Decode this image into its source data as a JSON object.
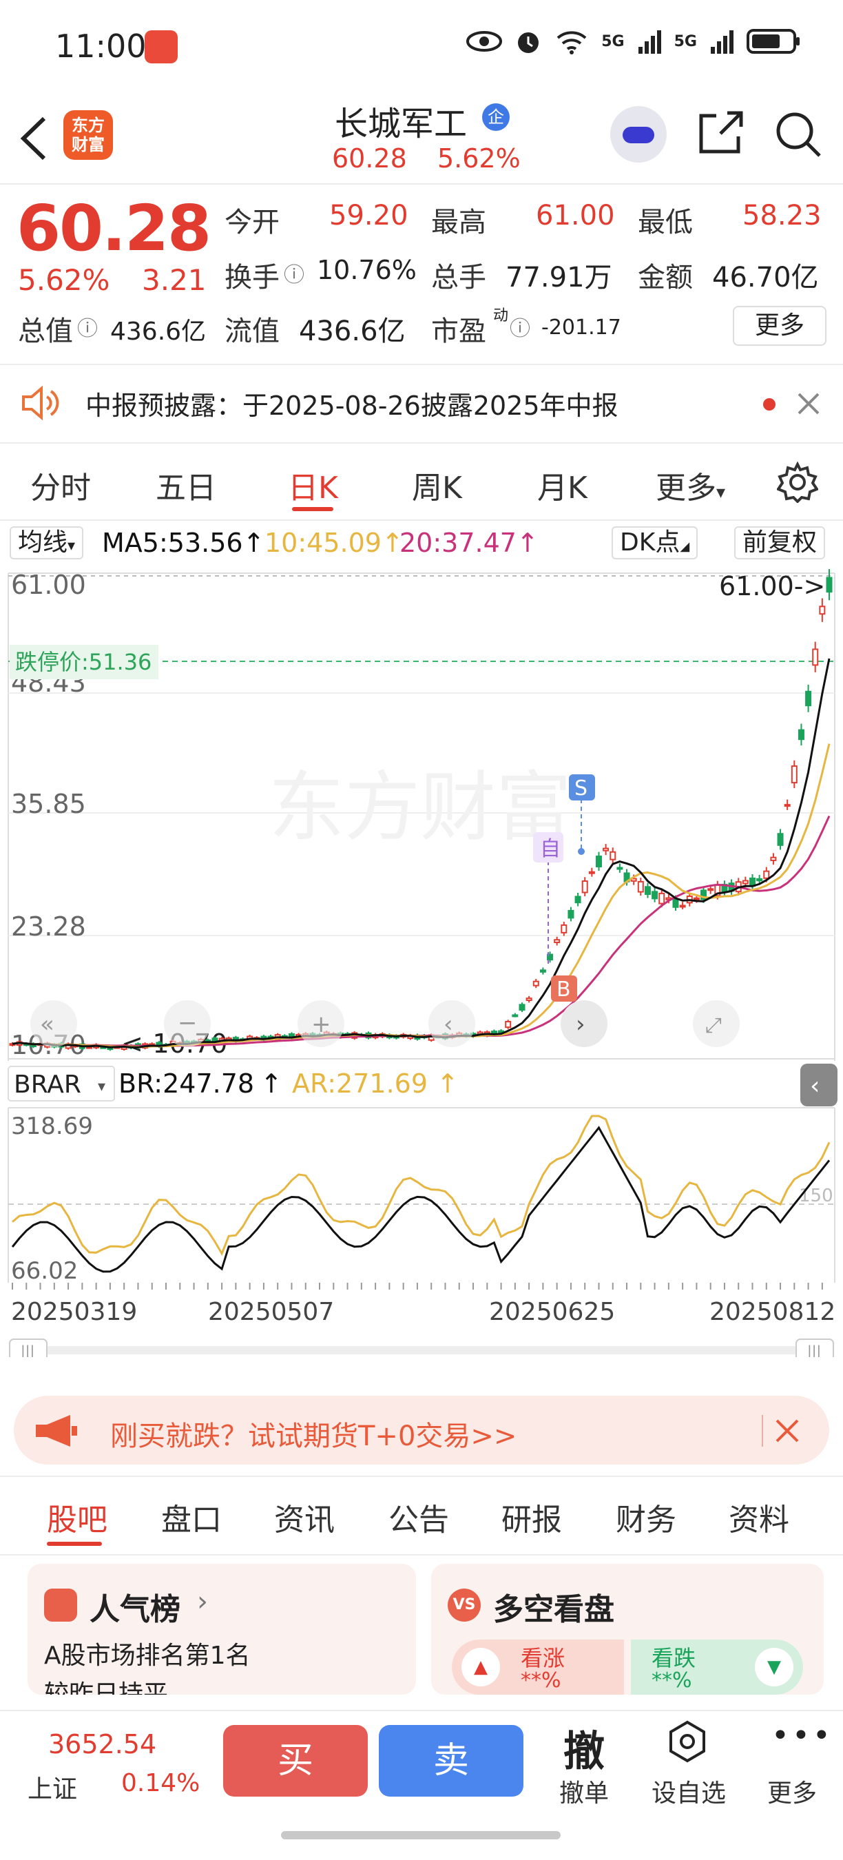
{
  "status_bar": {
    "time": "11:00",
    "network_1": "5G",
    "network_2": "5G"
  },
  "header": {
    "back_icon": "back-arrow-icon",
    "logo_text": "东方财富",
    "title": "长城军工",
    "title_badge": "企",
    "subtitle_price": "60.28",
    "subtitle_change": "5.62%"
  },
  "quote": {
    "price": "60.28",
    "change_pct": "5.62%",
    "change_abs": "3.21",
    "open_label": "今开",
    "open": "59.20",
    "high_label": "最高",
    "high": "61.00",
    "low_label": "最低",
    "low": "58.23",
    "turnover_label": "换手",
    "turnover": "10.76%",
    "volume_label": "总手",
    "volume": "77.91万",
    "amount_label": "金额",
    "amount": "46.70亿",
    "mktcap_label": "总值",
    "mktcap": "436.6亿",
    "float_label": "流值",
    "float": "436.6亿",
    "pe_label": "市盈",
    "pe_sup": "动",
    "pe": "-201.17",
    "more_label": "更多"
  },
  "notice": {
    "text": "中报预披露：于2025-08-26披露2025年中报"
  },
  "chart_tabs": [
    "分时",
    "五日",
    "日K",
    "周K",
    "月K",
    "更多"
  ],
  "chart_tabs_active": 2,
  "chart_toolbar": {
    "ma_select": "均线",
    "ma5": "MA5:53.56",
    "ma10": "10:45.09",
    "ma20": "20:37.47",
    "dk_label": "DK点",
    "adjust_label": "前复权",
    "limit_down_label": "跌停价:51.36",
    "max_marker": "61.00->",
    "min_marker": "<-10.70",
    "marker_self": "自",
    "marker_s": "S",
    "marker_b": "B",
    "watermark": "东方财富",
    "y_ticks": [
      "61.00",
      "48.43",
      "35.85",
      "23.28",
      "10.70"
    ]
  },
  "indicator": {
    "select": "BRAR",
    "br": "BR:247.78",
    "ar": "AR:271.69",
    "y_ticks": [
      "318.69",
      "66.02"
    ],
    "ref_label": "150",
    "x_ticks": [
      "20250319",
      "20250507",
      "20250625",
      "20250812"
    ]
  },
  "colors": {
    "up": "#e23c30",
    "down": "#1aa35a",
    "ma5": "#111111",
    "ma10": "#e6b640",
    "ma20": "#c8327a",
    "br": "#111111",
    "ar": "#e6b640"
  },
  "chart_data": {
    "type": "line",
    "title": "",
    "series": [
      {
        "name": "MA5",
        "x": [
          "20250319",
          "20250507",
          "20250625",
          "20250812"
        ],
        "values": [
          11.0,
          12.0,
          30.0,
          53.56
        ]
      },
      {
        "name": "10",
        "x": [
          "20250319",
          "20250507",
          "20250625",
          "20250812"
        ],
        "values": [
          11.0,
          12.0,
          27.0,
          45.09
        ]
      },
      {
        "name": "20",
        "x": [
          "20250319",
          "20250507",
          "20250625",
          "20250812"
        ],
        "values": [
          11.0,
          11.8,
          22.0,
          37.47
        ]
      }
    ],
    "ylim": [
      10.7,
      61.0
    ]
  },
  "promo": {
    "text": "刚买就跌？试试期货T+0交易>>"
  },
  "section_tabs": [
    "股吧",
    "盘口",
    "资讯",
    "公告",
    "研报",
    "财务",
    "资料"
  ],
  "section_tabs_active": 0,
  "cards": {
    "popular_title": "人气榜",
    "popular_line1": "A股市场排名第1名",
    "popular_line2": "较昨日持平",
    "vs_title": "多空看盘",
    "bull_label": "看涨",
    "bull_value": "**%",
    "bear_label": "看跌",
    "bear_value": "**%"
  },
  "bottom_bar": {
    "index_value": "3652.54",
    "index_name": "上证",
    "index_change": "0.14%",
    "buy": "买",
    "sell": "卖",
    "cancel_glyph": "撤",
    "cancel_label": "撤单",
    "watch_label": "设自选",
    "more_label": "更多"
  }
}
